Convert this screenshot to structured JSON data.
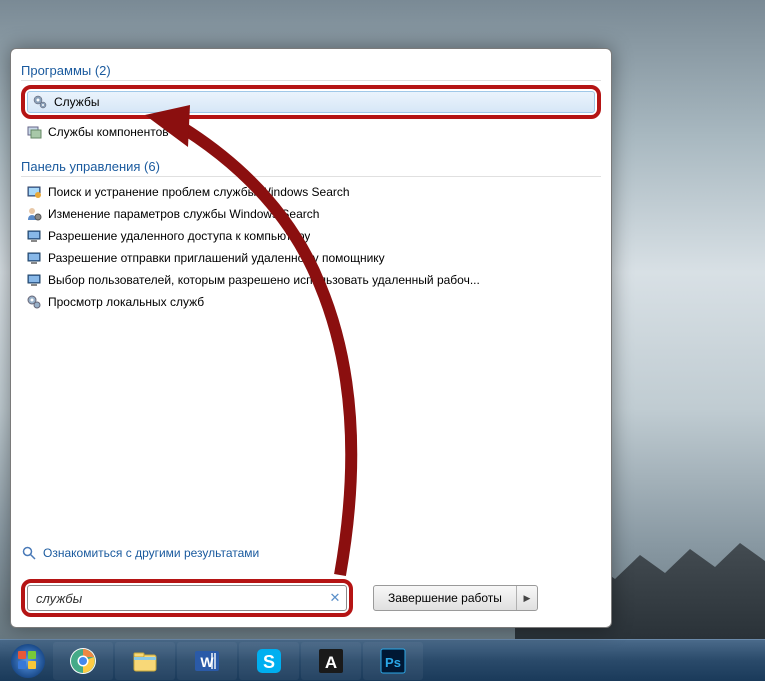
{
  "programs": {
    "header": "Программы (2)",
    "items": [
      {
        "label": "Службы",
        "icon": "gears-icon",
        "selected": true
      },
      {
        "label": "Службы компонентов",
        "icon": "component-icon",
        "selected": false
      }
    ]
  },
  "control_panel": {
    "header": "Панель управления (6)",
    "items": [
      {
        "label": "Поиск и устранение проблем службы Windows Search",
        "icon": "troubleshoot-icon"
      },
      {
        "label": "Изменение параметров службы Windows Search",
        "icon": "user-settings-icon"
      },
      {
        "label": "Разрешение удаленного доступа к компьютеру",
        "icon": "system-icon"
      },
      {
        "label": "Разрешение отправки приглашений удаленному помощнику",
        "icon": "system-icon"
      },
      {
        "label": "Выбор пользователей, которым разрешено использовать удаленный рабоч...",
        "icon": "system-icon"
      },
      {
        "label": "Просмотр локальных служб",
        "icon": "admin-tools-icon"
      }
    ]
  },
  "more_results": {
    "label": "Ознакомиться с другими результатами"
  },
  "search": {
    "value": "службы"
  },
  "shutdown": {
    "label": "Завершение работы"
  },
  "taskbar": {
    "apps": [
      {
        "name": "chrome"
      },
      {
        "name": "explorer"
      },
      {
        "name": "word"
      },
      {
        "name": "skype"
      },
      {
        "name": "autocad"
      },
      {
        "name": "photoshop"
      }
    ]
  }
}
